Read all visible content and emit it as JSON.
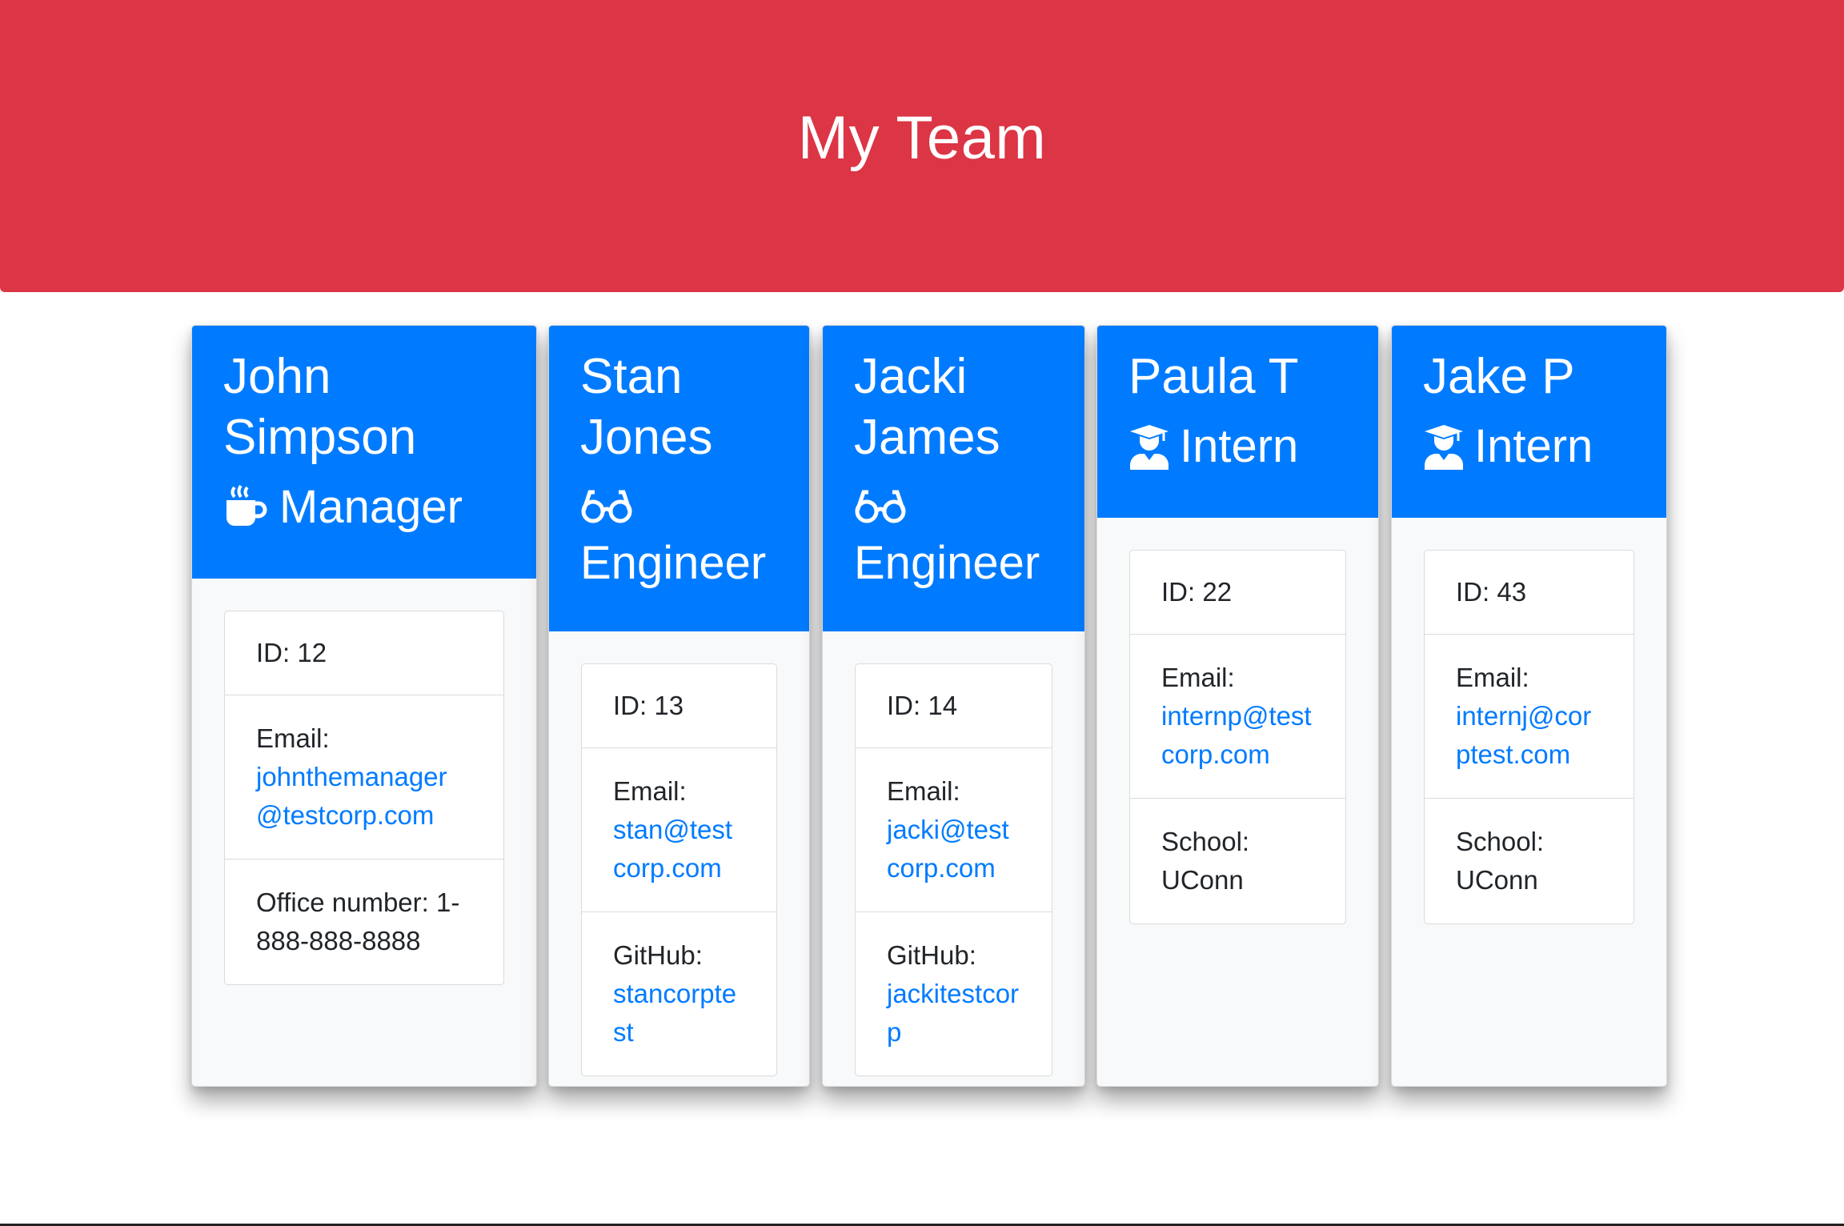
{
  "header": {
    "title": "My Team"
  },
  "colors": {
    "header_bg": "#dc3545",
    "card_header_bg": "#007bff",
    "link": "#007bff",
    "card_body_bg": "#f8f9fa"
  },
  "team": [
    {
      "name": "John Simpson",
      "role": "Manager",
      "role_icon": "mug-hot-icon",
      "id_label": "ID:",
      "id": "12",
      "email_label": "Email:",
      "email": "johnthemanager@testcorp.com",
      "extra_label": "Office number:",
      "extra_value": "1-888-888-8888"
    },
    {
      "name": "Stan Jones",
      "role": "Engineer",
      "role_icon": "glasses-icon",
      "id_label": "ID:",
      "id": "13",
      "email_label": "Email:",
      "email": "stan@testcorp.com",
      "extra_label": "GitHub:",
      "extra_value": "stancorptest"
    },
    {
      "name": "Jacki James",
      "role": "Engineer",
      "role_icon": "glasses-icon",
      "id_label": "ID:",
      "id": "14",
      "email_label": "Email:",
      "email": "jacki@testcorp.com",
      "extra_label": "GitHub:",
      "extra_value": "jackitestcorp"
    },
    {
      "name": "Paula T",
      "role": "Intern",
      "role_icon": "user-graduate-icon",
      "id_label": "ID:",
      "id": "22",
      "email_label": "Email:",
      "email": "internp@testcorp.com",
      "extra_label": "School:",
      "extra_value": "UConn"
    },
    {
      "name": "Jake P",
      "role": "Intern",
      "role_icon": "user-graduate-icon",
      "id_label": "ID:",
      "id": "43",
      "email_label": "Email:",
      "email": "internj@corptest.com",
      "extra_label": "School:",
      "extra_value": "UConn"
    }
  ]
}
